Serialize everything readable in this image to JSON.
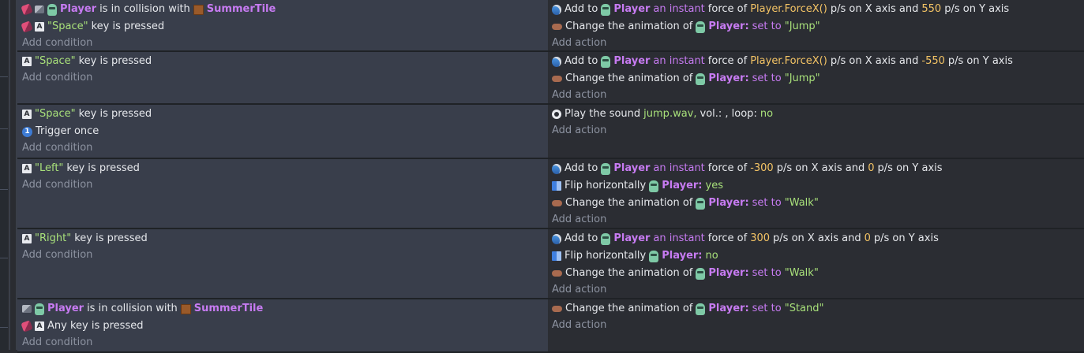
{
  "events": [
    {
      "conditions": [
        {
          "icons": [
            "collision-icon",
            "movable-icon"
          ],
          "parts": [
            {
              "k": "obj",
              "v": "Player"
            },
            {
              "k": "t",
              "v": "is in collision with"
            },
            {
              "k": "tile",
              "v": "SummerTile"
            }
          ]
        },
        {
          "icons": [
            "collision-icon",
            "key-icon"
          ],
          "parts": [
            {
              "k": "str",
              "v": "\"Space\""
            },
            {
              "k": "t",
              "v": "key is pressed"
            }
          ]
        }
      ],
      "actions": [
        {
          "icon": "force-icon",
          "parts": [
            {
              "k": "t",
              "v": "Add to"
            },
            {
              "k": "obj",
              "v": "Player"
            },
            {
              "k": "purple",
              "v": "an instant"
            },
            {
              "k": "t",
              "v": "force of"
            },
            {
              "k": "expr",
              "v": "Player.ForceX()"
            },
            {
              "k": "t",
              "v": "p/s on X axis and"
            },
            {
              "k": "num",
              "v": "550"
            },
            {
              "k": "t",
              "v": "p/s on Y axis"
            }
          ]
        },
        {
          "icon": "animation-icon",
          "parts": [
            {
              "k": "t",
              "v": "Change the animation of"
            },
            {
              "k": "objc",
              "v": "Player:"
            },
            {
              "k": "purple",
              "v": "set to"
            },
            {
              "k": "str",
              "v": "\"Jump\""
            }
          ]
        }
      ],
      "height": 64
    },
    {
      "conditions": [
        {
          "icons": [
            "key-icon"
          ],
          "parts": [
            {
              "k": "str",
              "v": "\"Space\""
            },
            {
              "k": "t",
              "v": "key is pressed"
            }
          ]
        }
      ],
      "actions": [
        {
          "icon": "force-icon",
          "parts": [
            {
              "k": "t",
              "v": "Add to"
            },
            {
              "k": "obj",
              "v": "Player"
            },
            {
              "k": "purple",
              "v": "an instant"
            },
            {
              "k": "t",
              "v": "force of"
            },
            {
              "k": "expr",
              "v": "Player.ForceX()"
            },
            {
              "k": "t",
              "v": "p/s on X axis and"
            },
            {
              "k": "num",
              "v": "-550"
            },
            {
              "k": "t",
              "v": "p/s on Y axis"
            }
          ]
        },
        {
          "icon": "animation-icon",
          "parts": [
            {
              "k": "t",
              "v": "Change the animation of"
            },
            {
              "k": "objc",
              "v": "Player:"
            },
            {
              "k": "purple",
              "v": "set to"
            },
            {
              "k": "str",
              "v": "\"Jump\""
            }
          ]
        }
      ],
      "height": 65
    },
    {
      "conditions": [
        {
          "icons": [
            "key-icon"
          ],
          "parts": [
            {
              "k": "str",
              "v": "\"Space\""
            },
            {
              "k": "t",
              "v": "key is pressed"
            }
          ]
        },
        {
          "icons": [
            "trigger-once-icon"
          ],
          "parts": [
            {
              "k": "t",
              "v": "Trigger once"
            }
          ]
        }
      ],
      "actions": [
        {
          "icon": "sound-icon",
          "parts": [
            {
              "k": "t",
              "v": "Play the sound"
            },
            {
              "k": "green",
              "v": "jump.wav,"
            },
            {
              "k": "t",
              "v": "vol.: , loop:"
            },
            {
              "k": "green",
              "v": "no"
            }
          ]
        }
      ],
      "height": 67
    },
    {
      "conditions": [
        {
          "icons": [
            "key-icon"
          ],
          "parts": [
            {
              "k": "str",
              "v": "\"Left\""
            },
            {
              "k": "t",
              "v": "key is pressed"
            }
          ]
        }
      ],
      "actions": [
        {
          "icon": "force-icon",
          "parts": [
            {
              "k": "t",
              "v": "Add to"
            },
            {
              "k": "obj",
              "v": "Player"
            },
            {
              "k": "purple",
              "v": "an instant"
            },
            {
              "k": "t",
              "v": "force of"
            },
            {
              "k": "num",
              "v": "-300"
            },
            {
              "k": "t",
              "v": "p/s on X axis and"
            },
            {
              "k": "num",
              "v": "0"
            },
            {
              "k": "t",
              "v": "p/s on Y axis"
            }
          ]
        },
        {
          "icon": "flip-icon",
          "parts": [
            {
              "k": "t",
              "v": "Flip horizontally"
            },
            {
              "k": "objc",
              "v": "Player:"
            },
            {
              "k": "green",
              "v": "yes"
            }
          ]
        },
        {
          "icon": "animation-icon",
          "parts": [
            {
              "k": "t",
              "v": "Change the animation of"
            },
            {
              "k": "objc",
              "v": "Player:"
            },
            {
              "k": "purple",
              "v": "set to"
            },
            {
              "k": "str",
              "v": "\"Walk\""
            }
          ]
        }
      ],
      "height": 87
    },
    {
      "conditions": [
        {
          "icons": [
            "key-icon"
          ],
          "parts": [
            {
              "k": "str",
              "v": "\"Right\""
            },
            {
              "k": "t",
              "v": "key is pressed"
            }
          ]
        }
      ],
      "actions": [
        {
          "icon": "force-icon",
          "parts": [
            {
              "k": "t",
              "v": "Add to"
            },
            {
              "k": "obj",
              "v": "Player"
            },
            {
              "k": "purple",
              "v": "an instant"
            },
            {
              "k": "t",
              "v": "force of"
            },
            {
              "k": "num",
              "v": "300"
            },
            {
              "k": "t",
              "v": "p/s on X axis and"
            },
            {
              "k": "num",
              "v": "0"
            },
            {
              "k": "t",
              "v": "p/s on Y axis"
            }
          ]
        },
        {
          "icon": "flip-icon",
          "parts": [
            {
              "k": "t",
              "v": "Flip horizontally"
            },
            {
              "k": "objc",
              "v": "Player:"
            },
            {
              "k": "green",
              "v": "no"
            }
          ]
        },
        {
          "icon": "animation-icon",
          "parts": [
            {
              "k": "t",
              "v": "Change the animation of"
            },
            {
              "k": "objc",
              "v": "Player:"
            },
            {
              "k": "purple",
              "v": "set to"
            },
            {
              "k": "str",
              "v": "\"Walk\""
            }
          ]
        }
      ],
      "height": 87
    },
    {
      "conditions": [
        {
          "icons": [
            "movable-icon"
          ],
          "parts": [
            {
              "k": "obj",
              "v": "Player"
            },
            {
              "k": "t",
              "v": "is in collision with"
            },
            {
              "k": "tile",
              "v": "SummerTile"
            }
          ]
        },
        {
          "icons": [
            "collision-icon",
            "key-icon"
          ],
          "parts": [
            {
              "k": "t",
              "v": "Any key is pressed"
            }
          ]
        }
      ],
      "actions": [
        {
          "icon": "animation-icon",
          "parts": [
            {
              "k": "t",
              "v": "Change the animation of"
            },
            {
              "k": "objc",
              "v": "Player:"
            },
            {
              "k": "purple",
              "v": "set to"
            },
            {
              "k": "str",
              "v": "\"Stand\""
            }
          ]
        }
      ],
      "height": 66
    }
  ],
  "add_condition_label": "Add condition",
  "add_action_label": "Add action",
  "colors": {
    "object": "#c77bf2",
    "string": "#a8e07a",
    "number": "#f4c465",
    "condition_bg": "#393e4b",
    "action_bg": "#2b2d33"
  }
}
